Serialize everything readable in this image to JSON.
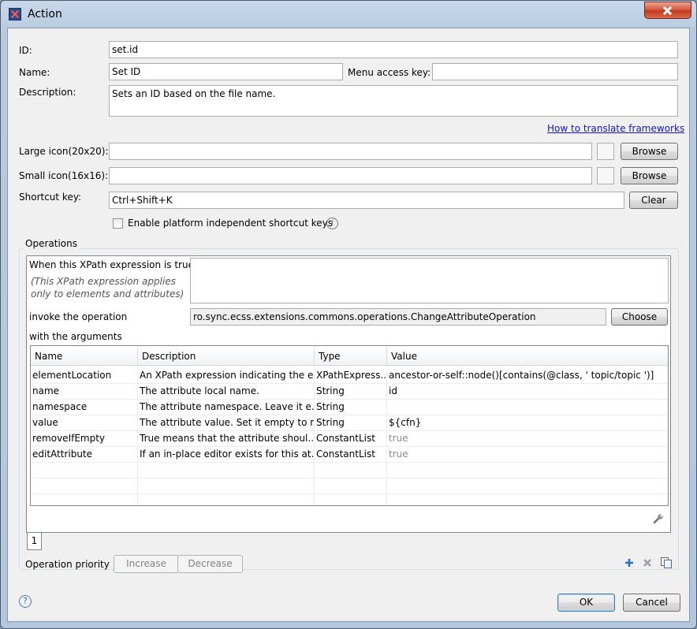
{
  "window": {
    "title": "Action",
    "app_icon": "oxygen-app-icon",
    "close_icon": "close-icon"
  },
  "form": {
    "id_label": "ID:",
    "id_value": "set.id",
    "name_label": "Name:",
    "name_value": "Set ID",
    "menu_access_key_label": "Menu access key:",
    "menu_access_key_value": "",
    "description_label": "Description:",
    "description_value": "Sets an ID based on the file name.",
    "translate_link": "How to translate frameworks",
    "large_icon_label": "Large icon(20x20):",
    "large_icon_value": "",
    "small_icon_label": "Small icon(16x16):",
    "small_icon_value": "",
    "browse_label": "Browse",
    "shortcut_label": "Shortcut key:",
    "shortcut_value": "Ctrl+Shift+K",
    "clear_label": "Clear",
    "platform_checkbox_label": "Enable platform independent shortcut keys",
    "platform_checkbox_checked": false
  },
  "operations": {
    "group_label": "Operations",
    "xpath_label": "When this XPath expression is true",
    "xpath_note_line1": "(This XPath expression applies",
    "xpath_note_line2": "only to elements and attributes)",
    "xpath_value": "",
    "invoke_label": "invoke the operation",
    "operation_value": "ro.sync.ecss.extensions.commons.operations.ChangeAttributeOperation",
    "choose_label": "Choose",
    "arguments_label": "with the arguments",
    "columns": [
      "Name",
      "Description",
      "Type",
      "Value"
    ],
    "rows": [
      [
        "elementLocation",
        "An XPath expression indicating the e...",
        "XPathExpress...",
        "ancestor-or-self::node()[contains(@class, ' topic/topic ')]"
      ],
      [
        "name",
        "The attribute local name.",
        "String",
        "id"
      ],
      [
        "namespace",
        "The attribute namespace. Leave it e...",
        "String",
        ""
      ],
      [
        "value",
        "The attribute value. Set it empty to r...",
        "String",
        "${cfn}"
      ],
      [
        "removeIfEmpty",
        "True means that the attribute shoul...",
        "ConstantList",
        "true"
      ],
      [
        "editAttribute",
        "If an in-place editor exists for this at...",
        "ConstantList",
        "true"
      ]
    ],
    "muted_value_rows": [
      4,
      5
    ],
    "tab_label": "1",
    "priority_label": "Operation priority",
    "increase_label": "Increase",
    "decrease_label": "Decrease"
  },
  "footer": {
    "ok_label": "OK",
    "cancel_label": "Cancel"
  },
  "colors": {
    "link": "#1515c8",
    "title_bar": "#b7cbe0",
    "close_button": "#c03b1f"
  }
}
